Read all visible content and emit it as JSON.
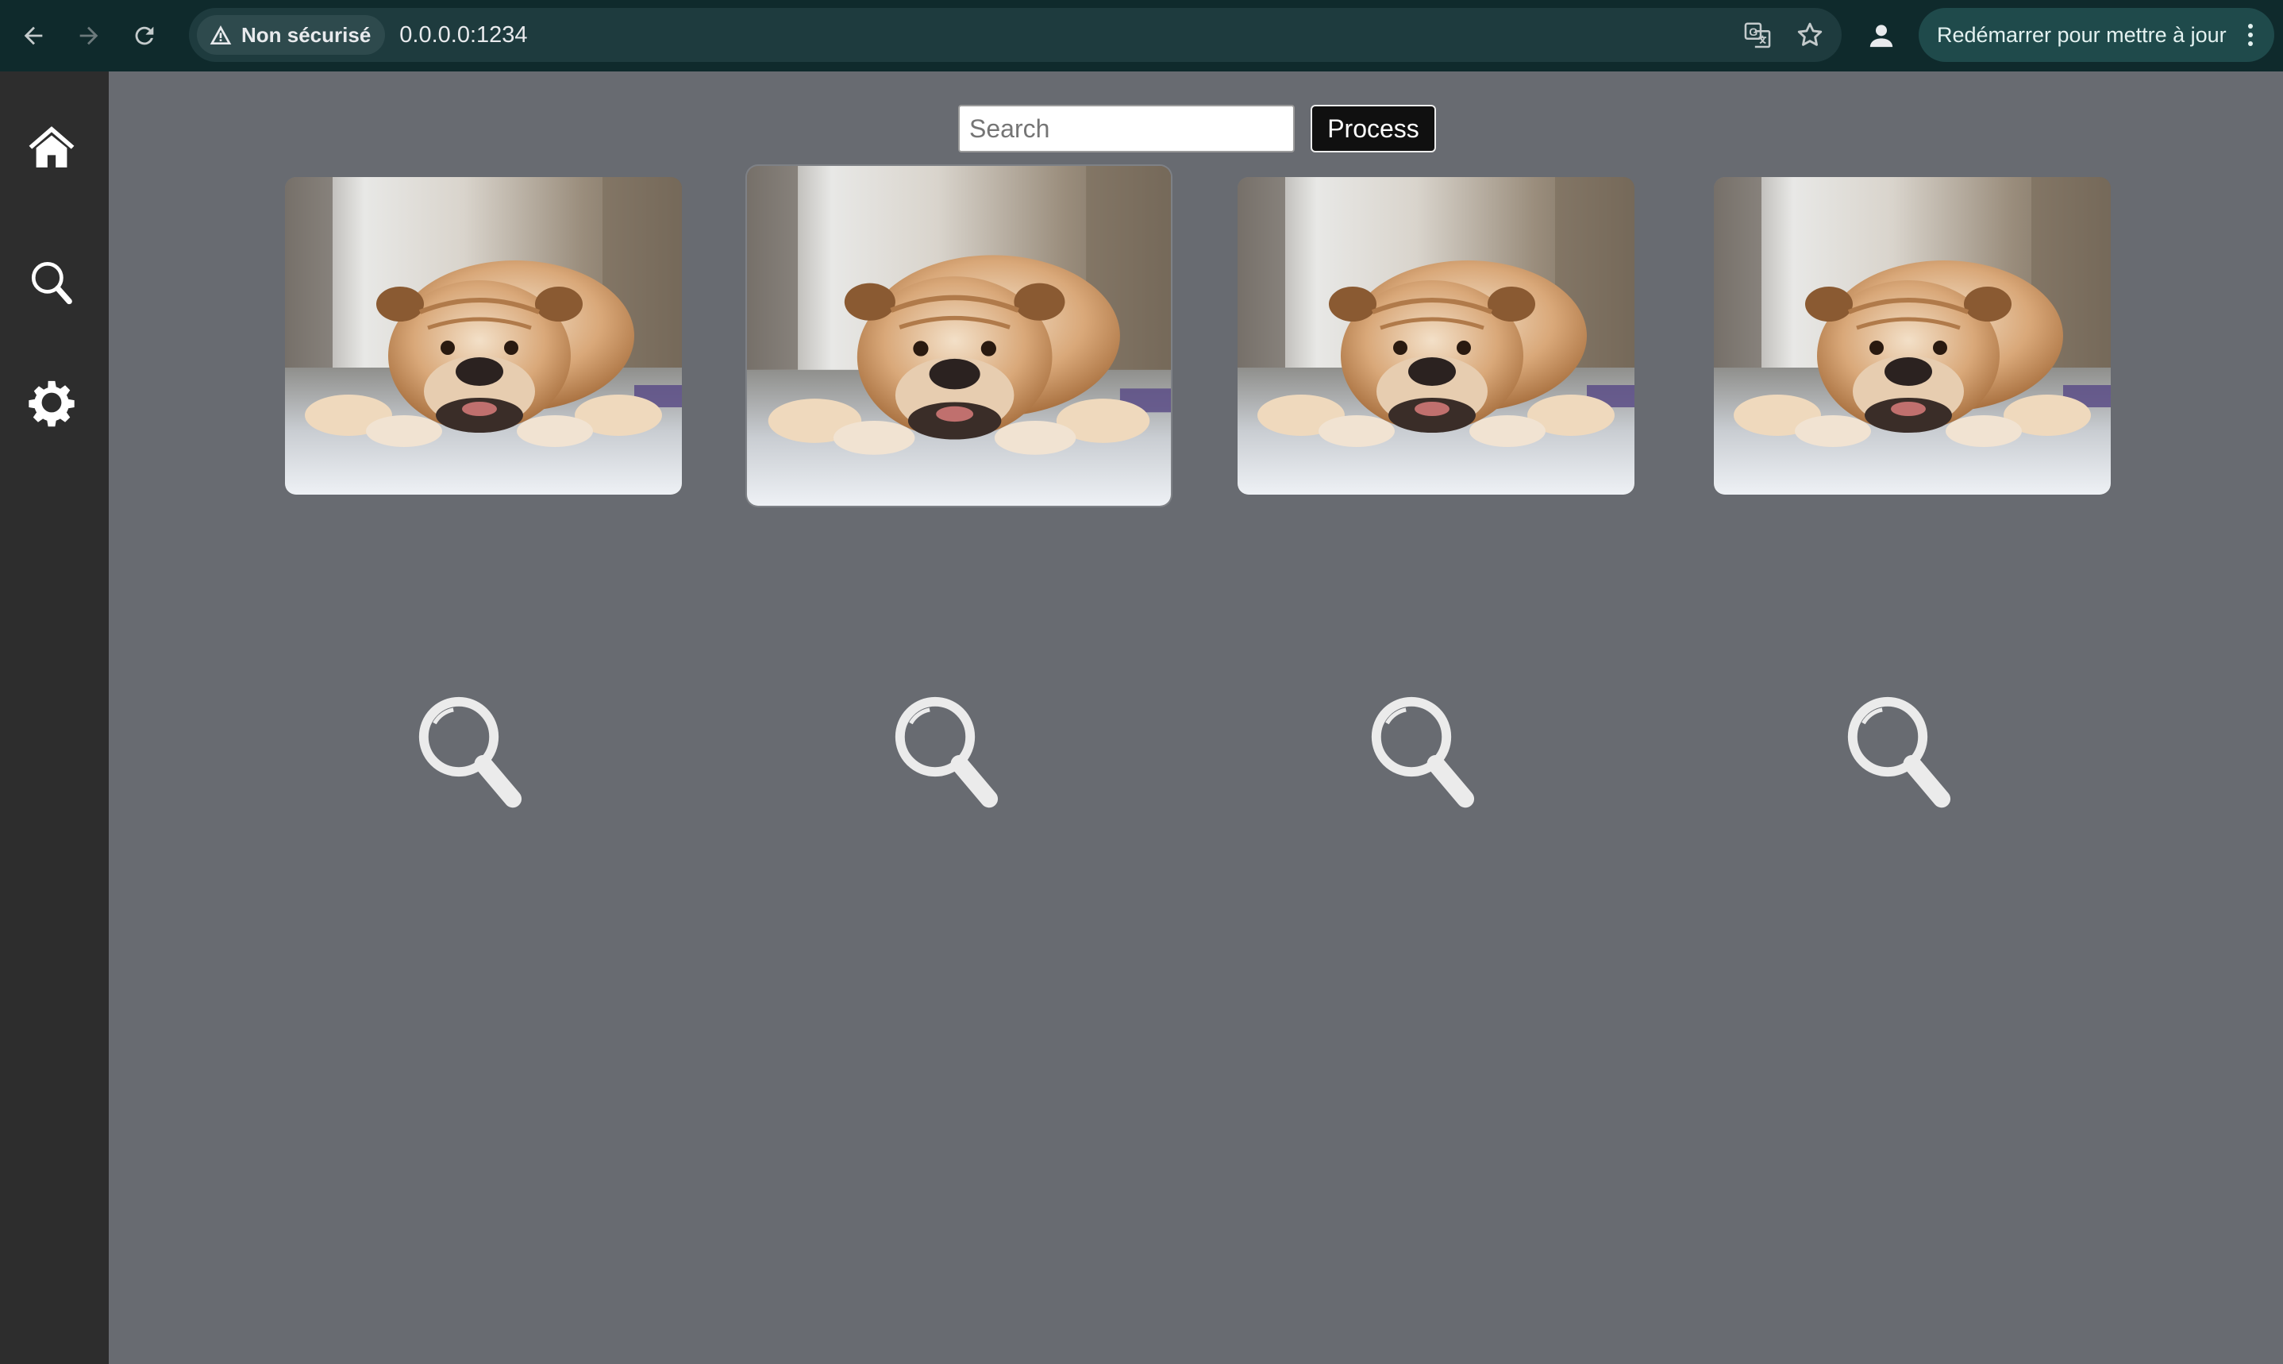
{
  "browser": {
    "security_label": "Non sécurisé",
    "url": "0.0.0.0:1234",
    "update_label": "Redémarrer pour mettre à jour",
    "icons": [
      "back-icon",
      "forward-icon",
      "reload-icon",
      "warning-icon",
      "translate-icon",
      "bookmark-star-icon",
      "profile-icon",
      "kebab-menu-icon"
    ]
  },
  "sidebar": {
    "items": [
      {
        "name": "home",
        "icon": "home-icon"
      },
      {
        "name": "search",
        "icon": "search-icon"
      },
      {
        "name": "settings",
        "icon": "gear-icon"
      }
    ]
  },
  "toolbar": {
    "search_placeholder": "Search",
    "search_value": "",
    "process_label": "Process"
  },
  "gallery": {
    "images": [
      {
        "subject": "bulldog lying on floor",
        "selected": false
      },
      {
        "subject": "bulldog lying on floor",
        "selected": true
      },
      {
        "subject": "bulldog lying on floor",
        "selected": false
      },
      {
        "subject": "bulldog lying on floor",
        "selected": false
      }
    ],
    "placeholders": [
      "magnifier-placeholder-icon",
      "magnifier-placeholder-icon",
      "magnifier-placeholder-icon",
      "magnifier-placeholder-icon"
    ]
  },
  "colors": {
    "chrome_bg": "#0f2a2c",
    "sidebar_bg": "#2d2d2d",
    "main_bg": "#686b71",
    "update_btn_bg": "#1f4a4b"
  }
}
